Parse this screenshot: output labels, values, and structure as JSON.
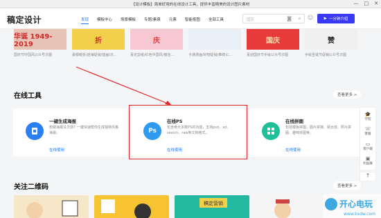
{
  "window": {
    "title": "【设计模板】简单好用的在线设计工具，提供丰富精美的设计图片素材",
    "controls": [
      "—",
      "□",
      "✕"
    ]
  },
  "navbar": {
    "logo": "稿定设计",
    "items": [
      {
        "label": "发现",
        "active": true
      },
      {
        "label": "模板中心",
        "active": false
      },
      {
        "label": "场景模板",
        "active": false
      },
      {
        "label": "专题/素泉",
        "active": false
      },
      {
        "label": "元素",
        "active": false
      },
      {
        "label": "智能抠图",
        "active": false
      },
      {
        "label": "全部工具",
        "active": false
      }
    ],
    "search_placeholder": "国庆",
    "start_label": "一分钟介绍"
  },
  "top_thumbs": [
    {
      "caption": "国庆节中国风公众号次图",
      "text": "华诞 1949-2019",
      "color": "#e8c4b6",
      "accent": "#d12a2a"
    },
    {
      "caption": "豪眼眼折/店铺促销/插画/次...",
      "text": "折",
      "color": "#f3d04a",
      "accent": "#d12a2a"
    },
    {
      "caption": "喜花剪纸/红色中国风/微信...",
      "text": "庆",
      "color": "#f6c8d4",
      "accent": "#e23c3c"
    },
    {
      "caption": "卡通漫画/好物促销/推荐公...",
      "text": "",
      "color": "#e8f0f6",
      "accent": "#7a8ea0"
    },
    {
      "caption": "喜迎国庆节手绘公众号次图",
      "text": "国庆",
      "color": "#e73a3a",
      "accent": "#f6e3b0"
    },
    {
      "caption": "手绘圣诞节促销公众号次图",
      "text": "赞",
      "color": "#f0f0f0",
      "accent": "#222222"
    }
  ],
  "online_tools": {
    "title": "在线工具",
    "more": "查看更多 >",
    "cards": [
      {
        "title": "一键生成海报",
        "desc": "想做海报没灵感？一键快速帮你生成独特风格海报。",
        "link": "在线使用",
        "icon_text": "",
        "icon_color": "#2b7ff5",
        "icon": "poster-icon"
      },
      {
        "title": "在线PS",
        "desc": "包含绝大多数PS的功能，支持psd、xd、sketch、raw等文档格式。",
        "link": "在线使用",
        "icon_text": "Ps",
        "icon_color": "#2e9bf0",
        "icon": "ps-icon"
      },
      {
        "title": "在线拼图",
        "desc": "包括模板拼图、图片拼接、朋太效、照片拼图、趣味拼图等。",
        "link": "在线使用",
        "icon_text": "",
        "icon_color": "#1fbf9a",
        "icon": "collage-icon"
      }
    ]
  },
  "qr_section": {
    "title": "关注二维码",
    "more": "查看更多 >"
  },
  "sidebar": {
    "items": [
      {
        "label": "学院",
        "icon": "cap-icon"
      },
      {
        "label": "客服",
        "icon": "headset-icon"
      },
      {
        "label": "客户端",
        "icon": "monitor-icon"
      },
      {
        "label": "利益群",
        "icon": "gift-icon"
      }
    ],
    "up": "↑"
  },
  "bottom_thumbs": [
    {
      "color": "#f6e7c8"
    },
    {
      "color": "#f7c330"
    },
    {
      "color": "#22b9a0"
    },
    {
      "color": "#f5f5f5"
    }
  ],
  "watermark": {
    "text": "开心电玩",
    "url": "www.kxdw.com"
  }
}
